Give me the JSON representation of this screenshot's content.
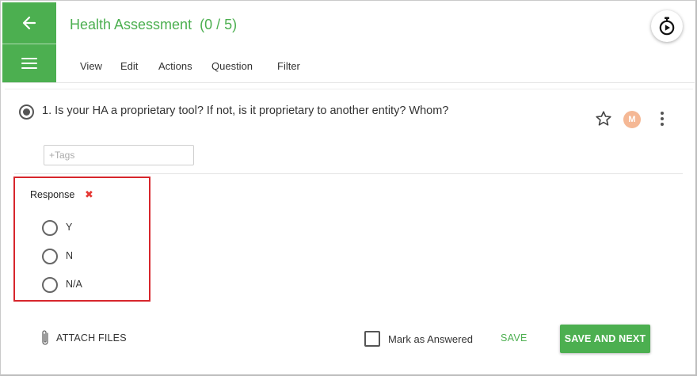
{
  "header": {
    "title": "Health Assessment",
    "progress": "(0 / 5)",
    "menu": [
      "View",
      "Edit",
      "Actions",
      "Question",
      "Filter"
    ]
  },
  "question": {
    "text": "1. Is your HA a proprietary tool? If not, is it proprietary to another entity? Whom?",
    "avatar_initial": "M",
    "tags_placeholder": "+Tags"
  },
  "response": {
    "label": "Response",
    "clear_icon": "✖",
    "options": [
      "Y",
      "N",
      "N/A"
    ]
  },
  "footer": {
    "attach_label": "ATTACH FILES",
    "mark_answered_label": "Mark as Answered",
    "save_label": "SAVE",
    "save_next_label": "SAVE AND NEXT"
  },
  "colors": {
    "accent": "#4caf50",
    "highlight_border": "#d7262c",
    "avatar": "#f5b895",
    "clear_icon": "#e53935"
  }
}
